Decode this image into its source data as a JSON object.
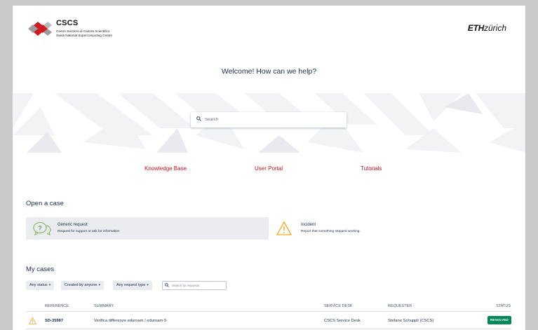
{
  "header": {
    "logo_name": "CSCS",
    "logo_line1": "Centro Svizzero di Calcolo Scientifico",
    "logo_line2": "Swiss National Supercomputing Centre",
    "eth_bold": "ETH",
    "eth_italic": "zürich"
  },
  "hero": {
    "welcome": "Welcome! How can we help?",
    "search_placeholder": "Search"
  },
  "quick_links": {
    "knowledge_base": "Knowledge Base",
    "user_portal": "User Portal",
    "tutorials": "Tutorials"
  },
  "open_case": {
    "title": "Open a case",
    "generic": {
      "title": "Generic request",
      "description": "Request for support or ask for information"
    },
    "incident": {
      "title": "Incident",
      "description": "Report that something stopped working."
    }
  },
  "my_cases": {
    "title": "My cases",
    "filters": {
      "status": "Any status",
      "created_by": "Created by anyone",
      "request_type": "Any request type",
      "search_placeholder": "Search for requests"
    },
    "columns": {
      "reference": "REFERENCE",
      "summary": "SUMMARY",
      "service_desk": "SERVICE DESK",
      "requester": "REQUESTER",
      "status": "STATUS"
    },
    "rows": [
      {
        "reference": "SD-35987",
        "summary": "Verifica differenze eduroam / eduroam-5",
        "service_desk": "CSCS Service Desk",
        "requester": "Stefano Schuppli (CSCS)",
        "status": "RESOLVED"
      }
    ]
  },
  "colors": {
    "brand_red": "#c0111f",
    "text_navy": "#172b4d",
    "resolved_green": "#00875a",
    "warning_orange": "#f5a623"
  }
}
